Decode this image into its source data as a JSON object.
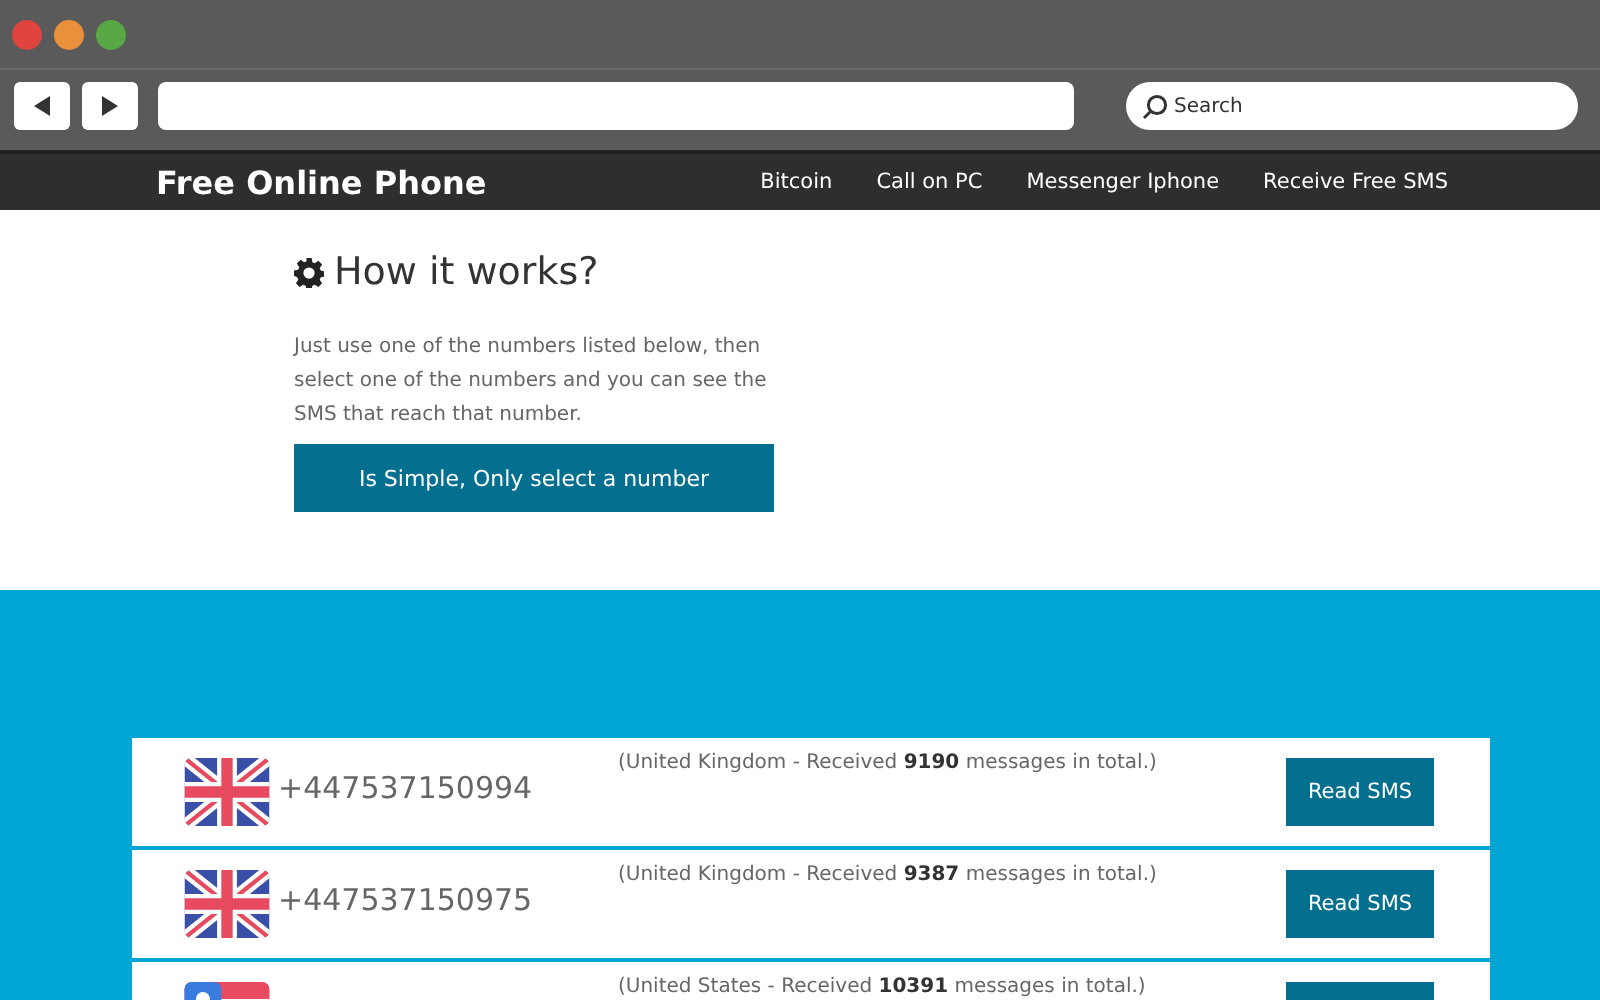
{
  "browser": {
    "search": {
      "placeholder": "Search"
    }
  },
  "site": {
    "brand": "Free Online Phone",
    "nav": [
      "Bitcoin",
      "Call on PC",
      "Messenger Iphone",
      "Receive Free SMS"
    ]
  },
  "intro": {
    "title": "How it works?",
    "text": "Just use one of the numbers listed below, then select one of the numbers and you can see the SMS that reach that number.",
    "button": "Is Simple, Only select a number"
  },
  "numbers": [
    {
      "kind": "uk",
      "number": "+447537150994",
      "info": "(United Kingdom - Received **9190** messages in total.)",
      "button": "Read SMS"
    },
    {
      "kind": "uk",
      "number": "+447537150975",
      "info": "(United Kingdom - Received **9387** messages in total.)",
      "button": "Read SMS"
    },
    {
      "kind": "us",
      "info": "(United States - Received **10391** messages in total.)"
    }
  ]
}
